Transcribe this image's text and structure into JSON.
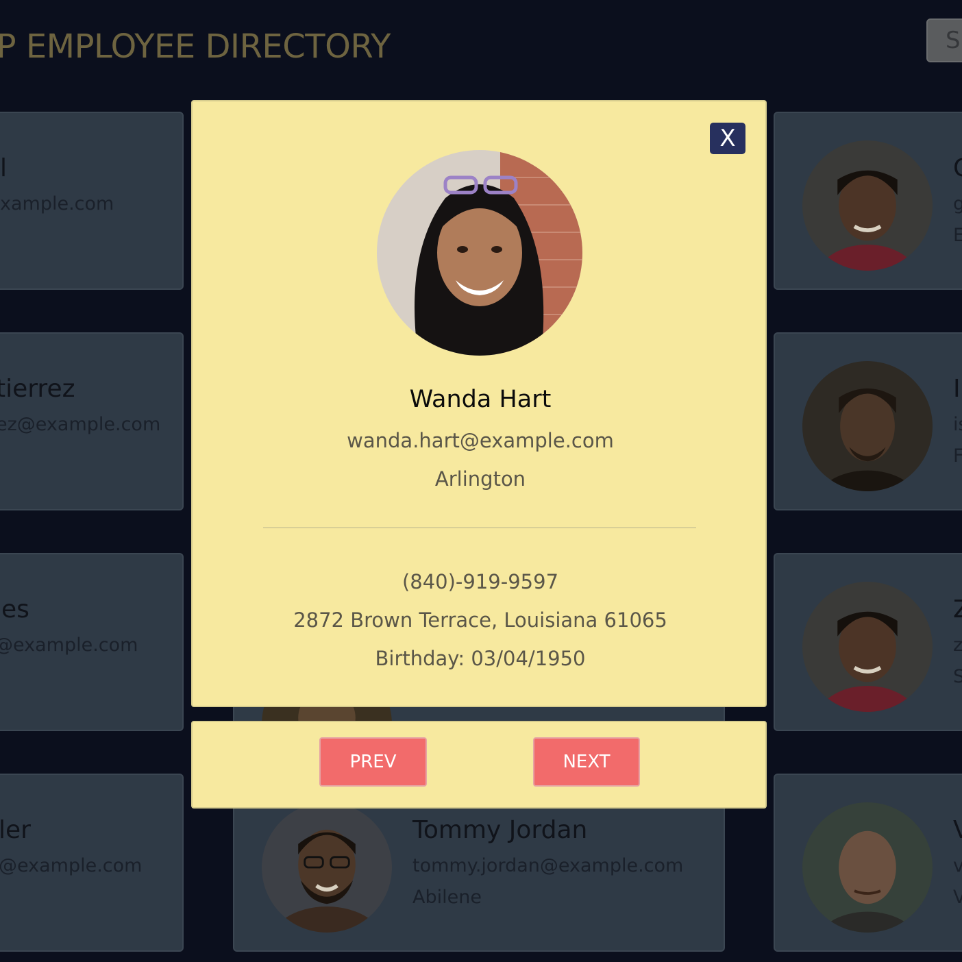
{
  "header": {
    "title": "UP EMPLOYEE DIRECTORY",
    "search_label": "S"
  },
  "directory": [
    {
      "name": "l",
      "email": "xample.com",
      "city": ""
    },
    {
      "name": "tierrez",
      "email": "ez@example.com",
      "city": ""
    },
    {
      "name": "les",
      "email": "@example.com",
      "city": ""
    },
    {
      "name": "ler",
      "email": "@example.com",
      "city": ""
    },
    {
      "name": "Tommy Jordan",
      "email": "tommy.jordan@example.com",
      "city": "Abilene"
    },
    {
      "name": "G",
      "email": "g",
      "city": "E"
    },
    {
      "name": "I",
      "email": "is",
      "city": "F"
    },
    {
      "name": "Z",
      "email": "z",
      "city": "S"
    },
    {
      "name": "V",
      "email": "v",
      "city": "V"
    }
  ],
  "modal": {
    "close_label": "X",
    "name": "Wanda Hart",
    "email": "wanda.hart@example.com",
    "city": "Arlington",
    "phone": "(840)-919-9597",
    "address": "2872 Brown Terrace, Louisiana 61065",
    "birthday": "Birthday: 03/04/1950",
    "prev_label": "PREV",
    "next_label": "NEXT"
  },
  "colors": {
    "background": "#0b0f1d",
    "modal": "#f7e99f",
    "close_button": "#27305e",
    "nav_button": "#f26b6b",
    "card": "#2f3a46"
  }
}
